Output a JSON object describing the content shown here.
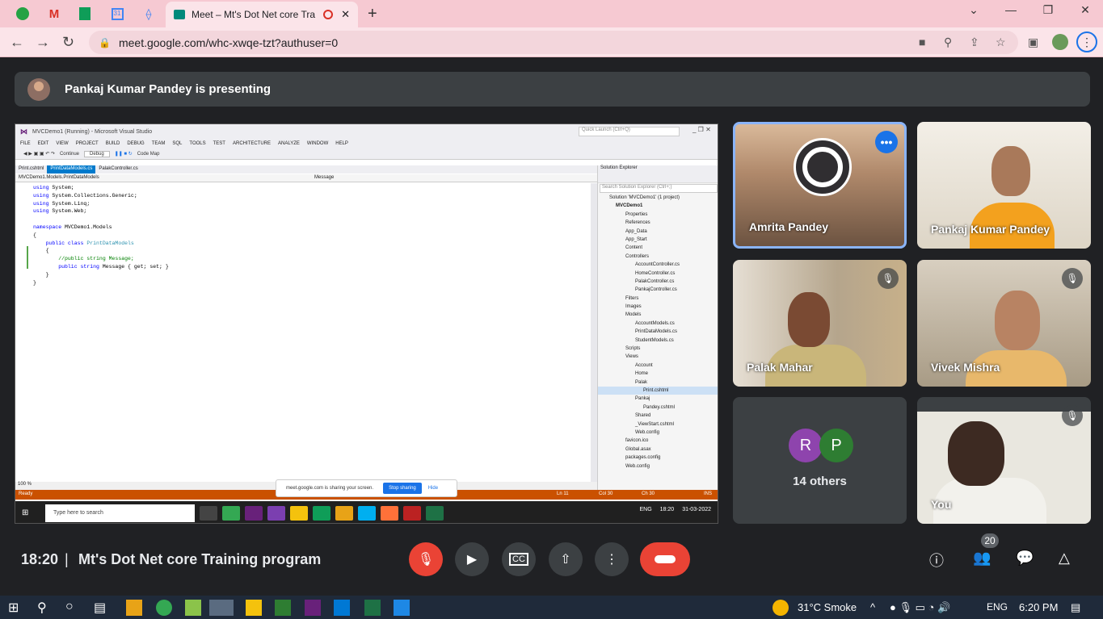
{
  "browser": {
    "tab_title": "Meet – Mt's Dot Net core Tra",
    "url": "meet.google.com/whc-xwqe-tzt?authuser=0"
  },
  "meet": {
    "presenting": "Pankaj Kumar Pandey is presenting",
    "time": "18:20",
    "separator": "|",
    "meeting_title": "Mt's Dot Net core Training program",
    "participants_count": "20",
    "tiles": [
      {
        "name": "Amrita Pandey"
      },
      {
        "name": "Pankaj Kumar Pandey"
      },
      {
        "name": "Palak Mahar"
      },
      {
        "name": "Vivek Mishra"
      },
      {
        "initials": [
          "R",
          "P"
        ],
        "others": "14 others"
      },
      {
        "name": "You"
      }
    ]
  },
  "vs": {
    "title": "MVCDemo1 (Running) - Microsoft Visual Studio",
    "quick_launch": "Quick Launch (Ctrl+Q)",
    "menu": [
      "FILE",
      "EDIT",
      "VIEW",
      "PROJECT",
      "BUILD",
      "DEBUG",
      "TEAM",
      "SQL",
      "TOOLS",
      "TEST",
      "ARCHITECTURE",
      "ANALYZE",
      "WINDOW",
      "HELP"
    ],
    "toolbar": {
      "continue": "Continue",
      "config": "Debug",
      "codemap": "Code Map"
    },
    "tabs": [
      "Print.cshtml",
      "PrintDataModels.cs",
      "PalakController.cs"
    ],
    "nav_left": "MVCDemo1.Models.PrintDataModels",
    "nav_right": "Message",
    "code": [
      [
        "using ",
        "System;"
      ],
      [
        "using ",
        "System.Collections.Generic;"
      ],
      [
        "using ",
        "System.Linq;"
      ],
      [
        "using ",
        "System.Web;"
      ],
      [
        "",
        ""
      ],
      [
        "namespace ",
        "MVCDemo1.Models"
      ],
      [
        "",
        "{"
      ],
      [
        "    public class ",
        "PrintDataModels"
      ],
      [
        "",
        "    {"
      ],
      [
        "",
        "        //public string Message;"
      ],
      [
        "        public string ",
        "Message { get; set; }"
      ],
      [
        "",
        "    }"
      ],
      [
        "",
        "}"
      ]
    ],
    "zoom": "100 %",
    "solution_title": "Solution Explorer",
    "solution_search": "Search Solution Explorer (Ctrl+;)",
    "tree": [
      "Solution 'MVCDemo1' (1 project)",
      "MVCDemo1",
      "Properties",
      "References",
      "App_Data",
      "App_Start",
      "Content",
      "Controllers",
      "AccountController.cs",
      "HomeController.cs",
      "PalakController.cs",
      "PankajController.cs",
      "Filters",
      "Images",
      "Models",
      "AccountModels.cs",
      "PrintDataModels.cs",
      "StudentModels.cs",
      "Scripts",
      "Views",
      "Account",
      "Home",
      "Palak",
      "Print.cshtml",
      "Pankaj",
      "Pandey.cshtml",
      "Shared",
      "_ViewStart.cshtml",
      "Web.config",
      "favicon.ico",
      "Global.asax",
      "packages.config",
      "Web.config"
    ],
    "status": {
      "ready": "Ready",
      "ln": "Ln 11",
      "col": "Col 30",
      "ch": "Ch 30",
      "ins": "INS"
    },
    "share": {
      "text": "meet.google.com is sharing your screen.",
      "stop": "Stop sharing",
      "hide": "Hide"
    },
    "inner_taskbar": {
      "search": "Type here to search",
      "time": "18:20",
      "date": "31-03-2022",
      "lang": "ENG"
    }
  },
  "taskbar": {
    "weather": "31°C  Smoke",
    "lang": "ENG",
    "time": "6:20 PM"
  }
}
